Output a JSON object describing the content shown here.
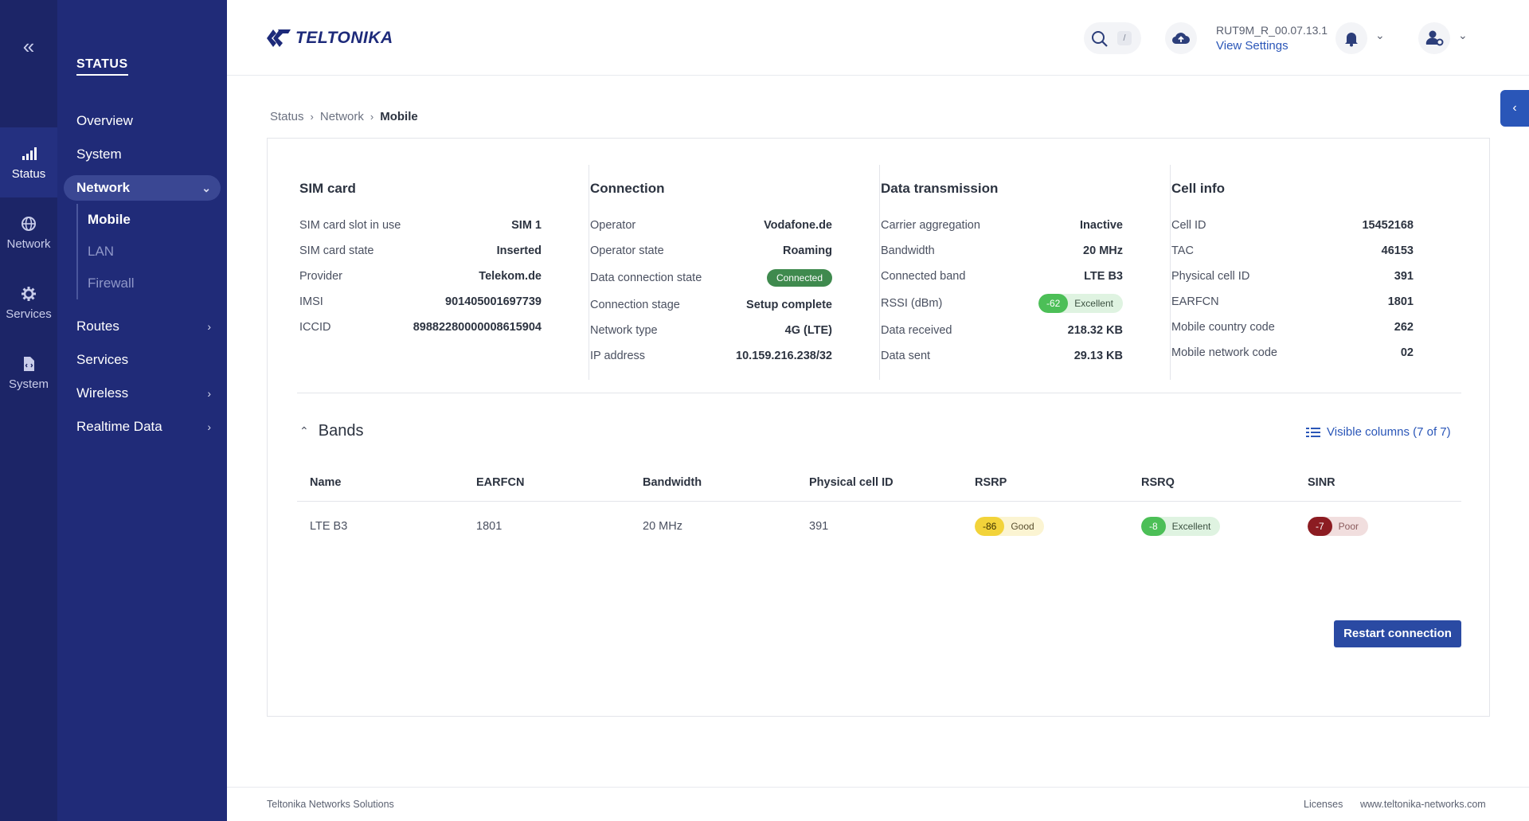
{
  "rail": {
    "collapse_icon": "double-chevron-left-icon",
    "items": [
      {
        "label": "Status",
        "icon": "signal-bars-icon",
        "active": true
      },
      {
        "label": "Network",
        "icon": "globe-icon"
      },
      {
        "label": "Services",
        "icon": "gear-icon"
      },
      {
        "label": "System",
        "icon": "document-code-icon"
      }
    ]
  },
  "menu": {
    "title": "STATUS",
    "items": [
      {
        "label": "Overview"
      },
      {
        "label": "System"
      },
      {
        "label": "Network",
        "expanded": true
      },
      {
        "label": "Routes",
        "has_children": true
      },
      {
        "label": "Services"
      },
      {
        "label": "Wireless",
        "has_children": true
      },
      {
        "label": "Realtime Data",
        "has_children": true
      }
    ],
    "network_sub": [
      "Mobile",
      "LAN",
      "Firewall"
    ]
  },
  "header": {
    "brand": "TELTONIKA",
    "search_shortcut": "/",
    "firmware": "RUT9M_R_00.07.13.1",
    "view_settings": "View Settings"
  },
  "breadcrumb": [
    "Status",
    "Network",
    "Mobile"
  ],
  "sim_card": {
    "title": "SIM card",
    "rows": [
      {
        "k": "SIM card slot in use",
        "v": "SIM 1"
      },
      {
        "k": "SIM card state",
        "v": "Inserted"
      },
      {
        "k": "Provider",
        "v": "Telekom.de"
      },
      {
        "k": "IMSI",
        "v": "901405001697739"
      },
      {
        "k": "ICCID",
        "v": "89882280000008615904"
      }
    ]
  },
  "connection": {
    "title": "Connection",
    "operator_k": "Operator",
    "operator_v": "Vodafone.de",
    "opstate_k": "Operator state",
    "opstate_v": "Roaming",
    "dcs_k": "Data connection state",
    "dcs_v": "Connected",
    "stage_k": "Connection stage",
    "stage_v": "Setup complete",
    "nettype_k": "Network type",
    "nettype_v": "4G (LTE)",
    "ip_k": "IP address",
    "ip_v": "10.159.216.238/32"
  },
  "data_tx": {
    "title": "Data transmission",
    "ca_k": "Carrier aggregation",
    "ca_v": "Inactive",
    "bw_k": "Bandwidth",
    "bw_v": "20 MHz",
    "band_k": "Connected band",
    "band_v": "LTE B3",
    "rssi_k": "RSSI (dBm)",
    "rssi_num": "-62",
    "rssi_lbl": "Excellent",
    "rx_k": "Data received",
    "rx_v": "218.32 KB",
    "tx_k": "Data sent",
    "tx_v": "29.13 KB"
  },
  "cell_info": {
    "title": "Cell info",
    "rows": [
      {
        "k": "Cell ID",
        "v": "15452168"
      },
      {
        "k": "TAC",
        "v": "46153"
      },
      {
        "k": "Physical cell ID",
        "v": "391"
      },
      {
        "k": "EARFCN",
        "v": "1801"
      },
      {
        "k": "Mobile country code",
        "v": "262"
      },
      {
        "k": "Mobile network code",
        "v": "02"
      }
    ]
  },
  "bands": {
    "title": "Bands",
    "visible_columns": "Visible columns (7 of 7)",
    "columns": [
      "Name",
      "EARFCN",
      "Bandwidth",
      "Physical cell ID",
      "RSRP",
      "RSRQ",
      "SINR"
    ],
    "row": {
      "name": "LTE B3",
      "earfcn": "1801",
      "bandwidth": "20 MHz",
      "pci": "391",
      "rsrp_num": "-86",
      "rsrp_lbl": "Good",
      "rsrq_num": "-8",
      "rsrq_lbl": "Excellent",
      "sinr_num": "-7",
      "sinr_lbl": "Poor"
    }
  },
  "restart_button": "Restart connection",
  "footer": {
    "company": "Teltonika Networks Solutions",
    "licenses": "Licenses",
    "website": "www.teltonika-networks.com"
  },
  "colors": {
    "rail_bg": "#1c2567",
    "menu_bg": "#202b78",
    "accent": "#2a56b8",
    "good": "#f2d33a",
    "excellent": "#4cbf57",
    "poor": "#8c1c22",
    "connected": "#3f8a4e"
  }
}
